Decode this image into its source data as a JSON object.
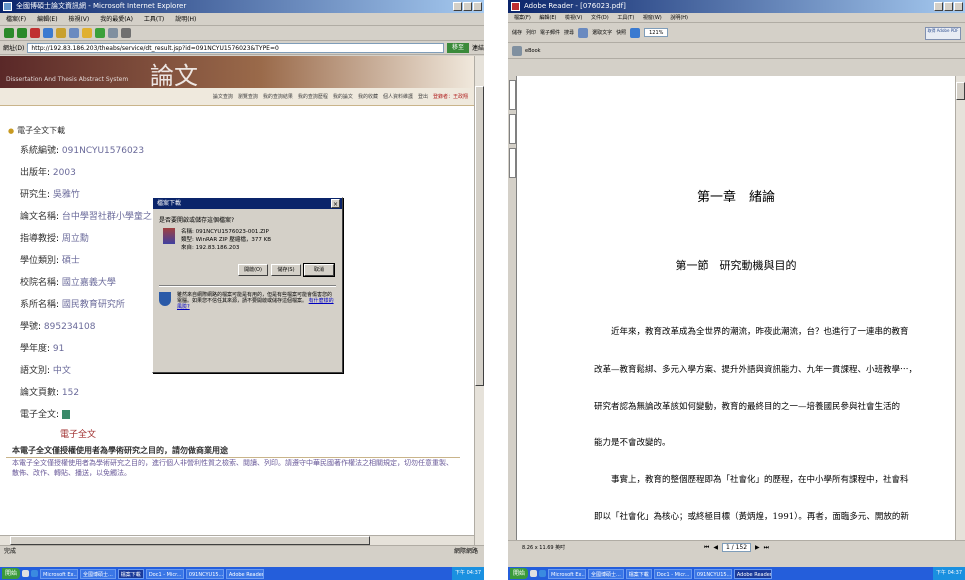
{
  "left_window": {
    "title": "全國博碩士論文資訊網 - Microsoft Internet Explorer",
    "menu": [
      "檔案(F)",
      "編輯(E)",
      "檢視(V)",
      "我的最愛(A)",
      "工具(T)",
      "說明(H)"
    ],
    "address_label": "網址(D)",
    "address_url": "http://192.83.186.203/theabs/service/dt_result.jsp?id=091NCYU1576023&TYPE=0",
    "go_label": "移至",
    "links_label": "連結",
    "banner_big": "論文",
    "banner_sub": "Dissertation And Thesis Abstract System",
    "nav_items": [
      "論文查詢",
      "瀏覽查詢",
      "我的查詢結果",
      "我的查詢歷程",
      "我的論文",
      "我的收藏",
      "個人資料維護",
      "登出"
    ],
    "login_status": "登錄者：王政翔",
    "section_title": "電子全文下載",
    "records": [
      {
        "key": "系統編號",
        "value": "091NCYU1576023"
      },
      {
        "key": "出版年",
        "value": "2003"
      },
      {
        "key": "研究生",
        "value": "吳雅竹"
      },
      {
        "key": "論文名稱",
        "value": "台中學習社群小學童之社會"
      },
      {
        "key": "指導教授",
        "value": "周立勳"
      },
      {
        "key": "學位類別",
        "value": "碩士"
      },
      {
        "key": "校院名稱",
        "value": "國立嘉義大學"
      },
      {
        "key": "系所名稱",
        "value": "國民教育研究所"
      },
      {
        "key": "學號",
        "value": "895234108"
      },
      {
        "key": "學年度",
        "value": "91"
      },
      {
        "key": "語文別",
        "value": "中文"
      },
      {
        "key": "論文頁數",
        "value": "152"
      },
      {
        "key": "電子全文",
        "value": ""
      }
    ],
    "fulltext_link": "電子全文",
    "auth_heading": "本電子全文僅授權使用者為學術研究之目的，請勿做商業用途",
    "auth_text": "本電子全文僅授權使用者為學術研究之目的，進行個人非營利性質之檢索、閱讀、列印。請遵守中華民國著作權法之相關規定，切勿任意重製、散佈、改作、轉貼、播送，以免觸法。",
    "status_left": "完成",
    "status_right": "網際網路"
  },
  "download_dialog": {
    "title": "檔案下載",
    "question": "是否要開啟或儲存這個檔案?",
    "name_label": "名稱",
    "name_value": "091NCYU1576023-001.ZIP",
    "type_label": "類型",
    "type_value": "WinRAR ZIP 壓縮檔，377 KB",
    "from_label": "來自",
    "from_value": "192.83.186.203",
    "open_button": "開啟(O)",
    "save_button": "儲存(S)",
    "cancel_button": "取消",
    "warning": "雖然來自網際網路的檔案可能是有用的，但是有些檔案可能會傷害您的電腦。如果您不信任其來源，請不要開啟或儲存這個檔案。",
    "risk_link": "有什麼樣的風險?"
  },
  "right_window": {
    "title": "Adobe Reader - [076023.pdf]",
    "menu": [
      "檔案(F)",
      "編輯(E)",
      "檢視(V)",
      "文件(D)",
      "工具(T)",
      "視窗(W)",
      "說明(H)"
    ],
    "toolbar_items": [
      "儲存",
      "列印",
      "電子郵件",
      "搜尋",
      "選取文字",
      "快照"
    ],
    "zoom": "121%",
    "ebook_label": "eBook",
    "logo_text": "取得 Adobe PDF",
    "chapter_title": "第一章　緒論",
    "section_heading": "第一節　研究動機與目的",
    "paragraphs": [
      "　　近年來，教育改革成為全世界的潮流，昨夜此潮流，台？也進行了一連串的教育",
      "改革—教育鬆綁、多元入學方案、提升外語與資訊能力、九年一貫課程、小班教學⋯，",
      "研究者認為無論改革該如何變動，教育的最終目的之一—培養國民參與社會生活的",
      "能力是不會改變的。",
      "　　事實上，教育的整個歷程即為「社會化」的歷程，在中小學所有課程中，社會科",
      "即以「社會化」為核心；或終極目標（黃炳煌，1991）。再者，面臨多元、開放的新"
    ],
    "page_size": "8.26 x 11.69 英吋",
    "page_indicator": "1 / 152"
  },
  "taskbar": {
    "start_label": "開始",
    "tasks": [
      "Microsoft Ex...",
      "全國博碩士...",
      "檔案下載",
      "Doc1 - Micr...",
      "091NCYU15...",
      "Adobe Reader"
    ],
    "clock": "下午 04:37"
  }
}
